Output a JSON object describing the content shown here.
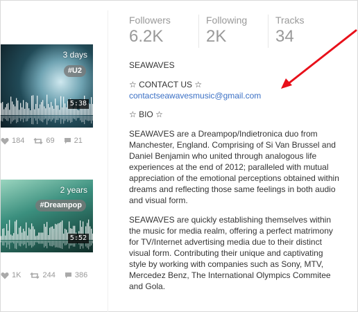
{
  "feed": [
    {
      "ago": "3 days",
      "tag": "#U2",
      "duration": "5:38",
      "likes": "184",
      "reposts": "69",
      "comments": "21"
    },
    {
      "ago": "2 years",
      "tag": "#Dreampop",
      "duration": "5:52",
      "likes": "1K",
      "reposts": "244",
      "comments": "386"
    }
  ],
  "profile": {
    "counts": [
      {
        "label": "Followers",
        "value": "6.2K"
      },
      {
        "label": "Following",
        "value": "2K"
      },
      {
        "label": "Tracks",
        "value": "34"
      }
    ],
    "name": "SEAWAVES",
    "contact_heading": "☆ CONTACT US ☆",
    "contact_email": "contactseawavesmusic@gmail.com",
    "bio_heading": "☆ BIO ☆",
    "bio_paragraph_1": "SEAWAVES are a Dreampop/Indietronica duo from Manchester, England. Comprising of Si Van Brussel and Daniel Benjamin who united through analogous life experiences at the end of 2012; paralleled with mutual appreciation of the emotional perceptions obtained within dreams and reflecting those same feelings in both audio and visual form.",
    "bio_paragraph_2": "SEAWAVES are quickly establishing themselves within the music for media realm, offering a perfect matrimony for TV/Internet advertising media due to their distinct visual form. Contributing their unique and captivating style by working with companies such as Sony, MTV, Mercedez Benz, The International Olympics Commitee and Gola."
  },
  "annotation": {
    "arrow_color": "#e8101a"
  }
}
